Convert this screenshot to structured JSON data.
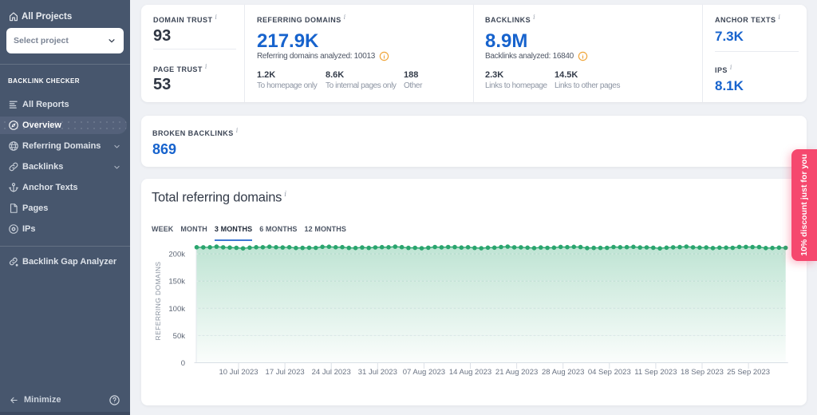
{
  "sidebar": {
    "all_projects_label": "All Projects",
    "project_select": {
      "placeholder": "Select project"
    },
    "section_label": "BACKLINK CHECKER",
    "items": [
      {
        "label": "All Reports",
        "icon": "report-lines-icon",
        "active": false,
        "expandable": false
      },
      {
        "label": "Overview",
        "icon": "compass-icon",
        "active": true,
        "expandable": false
      },
      {
        "label": "Referring Domains",
        "icon": "globe-icon",
        "active": false,
        "expandable": true
      },
      {
        "label": "Backlinks",
        "icon": "chain-link-icon",
        "active": false,
        "expandable": true
      },
      {
        "label": "Anchor Texts",
        "icon": "anchor-icon",
        "active": false,
        "expandable": false
      },
      {
        "label": "Pages",
        "icon": "page-icon",
        "active": false,
        "expandable": false
      },
      {
        "label": "IPs",
        "icon": "target-icon",
        "active": false,
        "expandable": false
      }
    ],
    "tools": [
      {
        "label": "Backlink Gap Analyzer",
        "icon": "link-gap-icon"
      }
    ],
    "minimize_label": "Minimize"
  },
  "metrics": {
    "domain_trust": {
      "label": "DOMAIN TRUST",
      "value": "93"
    },
    "page_trust": {
      "label": "PAGE TRUST",
      "value": "53"
    },
    "referring_domains": {
      "label": "REFERRING DOMAINS",
      "value": "217.9K",
      "analyzed": "Referring domains analyzed: 10013",
      "breakdown": [
        {
          "value": "1.2K",
          "label": "To homepage only"
        },
        {
          "value": "8.6K",
          "label": "To internal pages only"
        },
        {
          "value": "188",
          "label": "Other"
        }
      ]
    },
    "backlinks": {
      "label": "BACKLINKS",
      "value": "8.9M",
      "analyzed": "Backlinks analyzed: 16840",
      "breakdown": [
        {
          "value": "2.3K",
          "label": "Links to homepage"
        },
        {
          "value": "14.5K",
          "label": "Links to other pages"
        }
      ]
    },
    "anchor_texts": {
      "label": "ANCHOR TEXTS",
      "value": "7.3K"
    },
    "ips": {
      "label": "IPS",
      "value": "8.1K"
    },
    "broken_backlinks": {
      "label": "BROKEN BACKLINKS",
      "value": "869"
    }
  },
  "chart_card": {
    "title": "Total referring domains",
    "tabs": [
      {
        "label": "WEEK",
        "active": false
      },
      {
        "label": "MONTH",
        "active": false
      },
      {
        "label": "3 MONTHS",
        "active": true
      },
      {
        "label": "6 MONTHS",
        "active": false
      },
      {
        "label": "12 MONTHS",
        "active": false
      }
    ]
  },
  "promo_ribbon": {
    "text": "10% discount just for you",
    "color": "#f5486e"
  },
  "ui": {
    "info_superscript": "i"
  },
  "chart_data": {
    "type": "area",
    "title": "Total referring domains",
    "ylabel": "REFERRING DOMAINS",
    "xlabel": "",
    "grid": "on",
    "legend": "off",
    "ylim": [
      0,
      217000
    ],
    "y_ticks": [
      {
        "value": 0,
        "label": "0"
      },
      {
        "value": 50000,
        "label": "50k"
      },
      {
        "value": 100000,
        "label": "100k"
      },
      {
        "value": 150000,
        "label": "150k"
      },
      {
        "value": 200000,
        "label": "200k"
      }
    ],
    "x_tick_labels": [
      "10 Jul 2023",
      "17 Jul 2023",
      "24 Jul 2023",
      "31 Jul 2023",
      "07 Aug 2023",
      "14 Aug 2023",
      "21 Aug 2023",
      "28 Aug 2023",
      "04 Sep 2023",
      "11 Sep 2023",
      "18 Sep 2023",
      "25 Sep 2023"
    ],
    "series": [
      {
        "name": "Referring domains",
        "values": [
          212220,
          212020,
          212160,
          213200,
          212050,
          211560,
          211190,
          210150,
          211510,
          212240,
          212140,
          213020,
          212110,
          211740,
          212190,
          210870,
          210940,
          211300,
          211140,
          212870,
          213050,
          212230,
          212320,
          210960,
          210870,
          211680,
          210990,
          211830,
          212390,
          212130,
          213180,
          212290,
          211040,
          211200,
          210450,
          211340,
          212580,
          212010,
          212660,
          212490,
          211630,
          212160,
          211050,
          210460,
          211490,
          211460,
          212680,
          213320,
          211970,
          212020,
          211380,
          210720,
          211690,
          211140,
          211410,
          212690,
          212360,
          212900,
          212470,
          210710,
          211040,
          210950,
          211180,
          212620,
          212100,
          212250,
          212840,
          211740,
          211830,
          211230,
          210180,
          211500,
          211980,
          212430,
          213320,
          211970,
          211640,
          211790,
          210760,
          211390,
          211390,
          211170,
          212820,
          212790,
          212500,
          212450,
          210690,
          210780,
          211440,
          211140
        ]
      }
    ],
    "line_color": "#2aa56e",
    "area_fill_top": "rgba(42,165,110,0.30)",
    "area_fill_bottom": "rgba(42,165,110,0.02)"
  },
  "colors": {
    "sidebar_bg": "#47566d",
    "sidebar_active_bg": "#54617a",
    "main_bg": "#eff1f5",
    "accent_blue": "#1763cd",
    "tab_underline_blue": "#3c77d2",
    "warning_orange": "#f0a63c",
    "green_line": "#2aa56e",
    "ribbon_pink": "#f5486e"
  }
}
